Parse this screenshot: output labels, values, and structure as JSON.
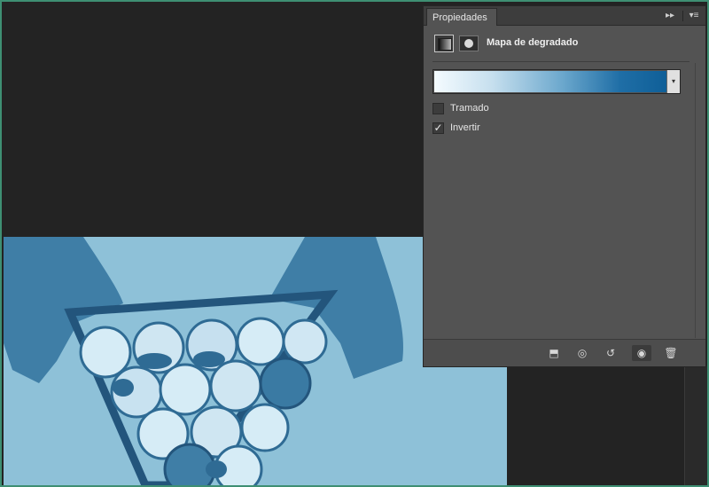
{
  "panel": {
    "tab_label": "Propiedades",
    "collapse_glyph": "▸▸",
    "menu_glyph": "▾≡",
    "layer_title": "Mapa de degradado",
    "adjustment_icon": "gradient-map-icon",
    "mask_icon": "layer-mask-icon",
    "gradient": {
      "colors": [
        "#f4fbff",
        "#6ca8cd",
        "#0f5f98"
      ],
      "dropdown_glyph": "▾"
    },
    "options": [
      {
        "label": "Tramado",
        "checked": false,
        "mark": ""
      },
      {
        "label": "Invertir",
        "checked": true,
        "mark": "✓"
      }
    ],
    "footer": {
      "clip": "⬒",
      "prev_state": "◎",
      "reset": "↺",
      "visibility": "◉",
      "delete": "🗑"
    }
  },
  "colors": {
    "app_bg": "#232323",
    "panel_bg": "#535353",
    "photo_tint": "#8ec1d8",
    "frame": "#3e8f73"
  }
}
